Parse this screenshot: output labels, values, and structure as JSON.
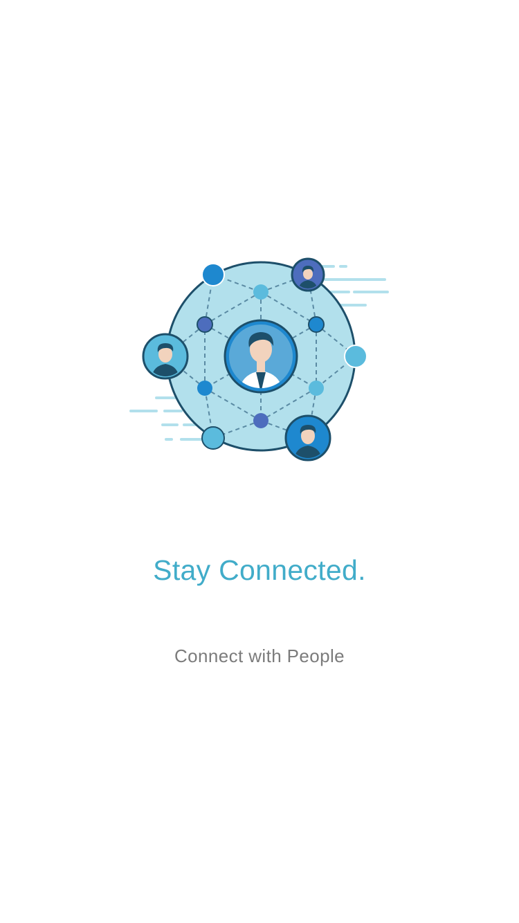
{
  "onboarding": {
    "illustration_icon": "network-people-icon",
    "title": "Stay Connected.",
    "subtitle": "Connect with People"
  },
  "colors": {
    "background": "#ffffff",
    "title": "#41acc9",
    "subtitle": "#7b7b7b",
    "globe_fill": "#b2e0ec",
    "globe_stroke": "#1d4f6a",
    "node_dark": "#1e88cf",
    "node_light": "#5bbbdd",
    "node_indigo": "#4d6dbd"
  }
}
